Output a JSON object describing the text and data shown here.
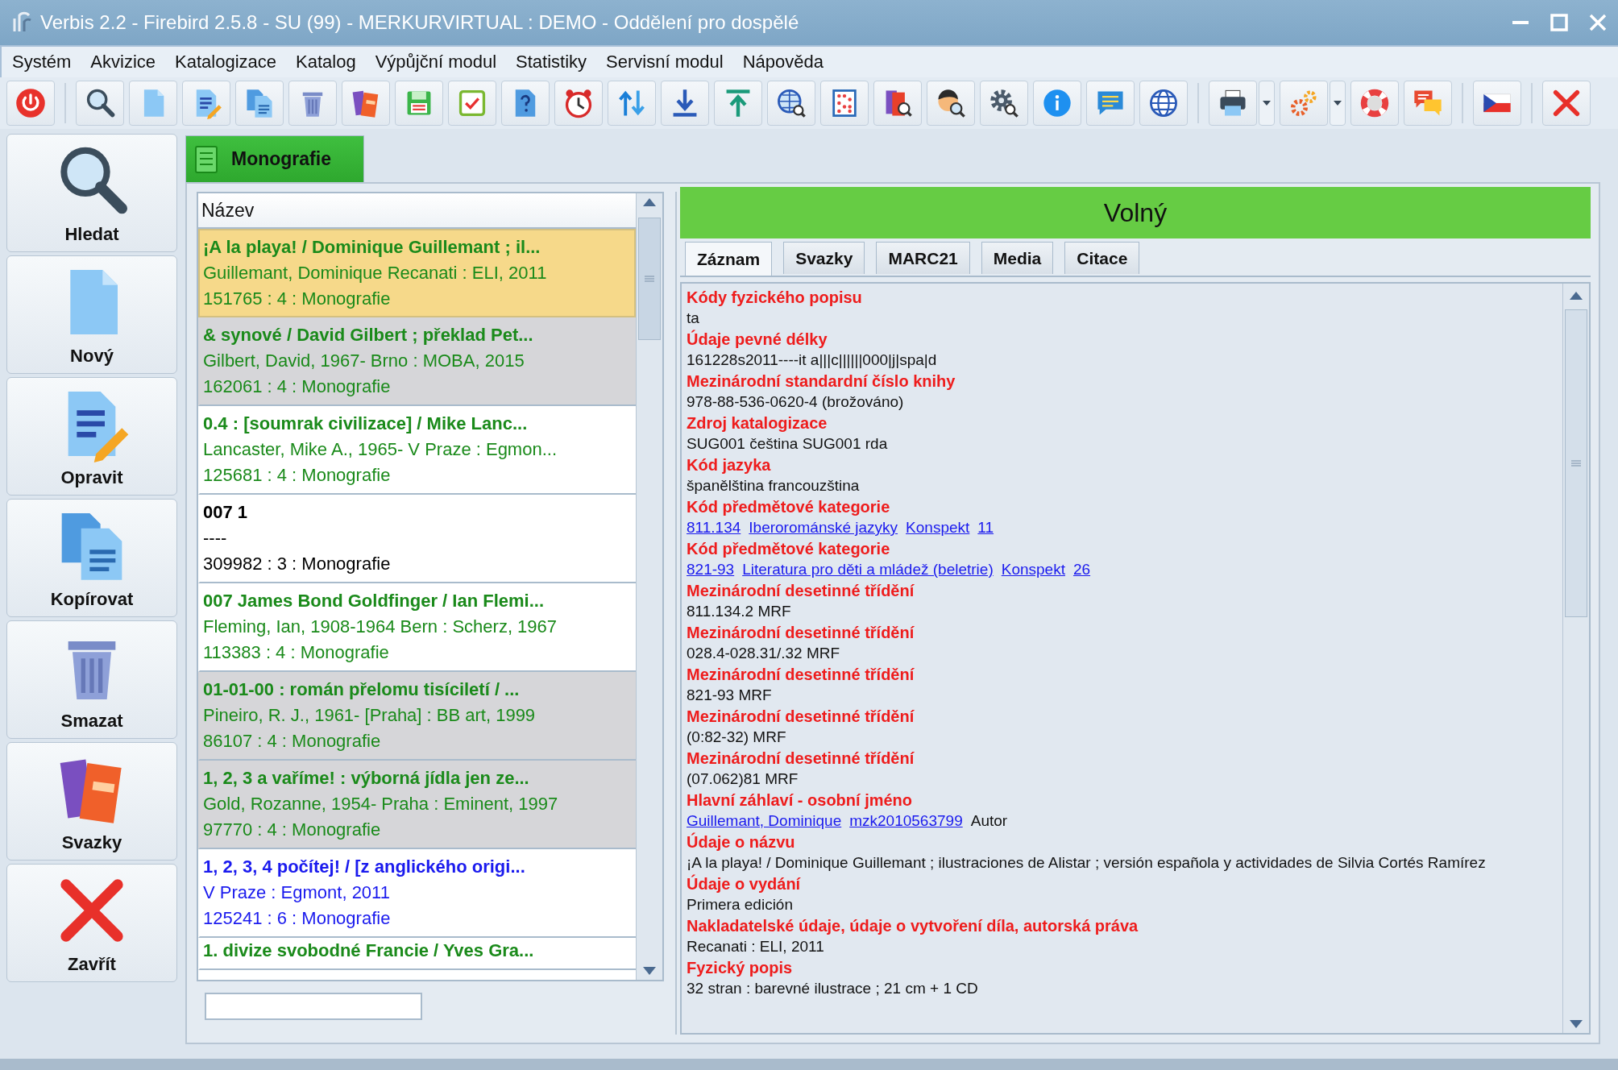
{
  "window": {
    "title": "Verbis 2.2 - Firebird 2.5.8 - SU (99) - MERKURVIRTUAL : DEMO - Oddělení pro dospělé"
  },
  "menu": [
    "Systém",
    "Akvizice",
    "Katalogizace",
    "Katalog",
    "Výpůjční modul",
    "Statistiky",
    "Servisní modul",
    "Nápověda"
  ],
  "sidebar": {
    "items": [
      {
        "label": "Hledat"
      },
      {
        "label": "Nový"
      },
      {
        "label": "Opravit"
      },
      {
        "label": "Kopírovat"
      },
      {
        "label": "Smazat"
      },
      {
        "label": "Svazky"
      },
      {
        "label": "Zavřít"
      }
    ]
  },
  "document_tab": {
    "label": "Monografie",
    "selected": true
  },
  "list": {
    "column": "Název",
    "rows": [
      {
        "title": "¡A la playa! / Dominique Guillemant ; il...",
        "line_2": "Guillemant, Dominique Recanati : ELI, 2011",
        "line_3": "151765 : 4 : Monografie",
        "color": "#1a8a1a",
        "shaded": false,
        "selected": true
      },
      {
        "title": "& synové / David Gilbert ; překlad Pet...",
        "line_2": "Gilbert, David, 1967- Brno : MOBA, 2015",
        "line_3": "162061 : 4 : Monografie",
        "color": "#1a8a1a",
        "shaded": true,
        "selected": false
      },
      {
        "title": "0.4 : [soumrak civilizace] / Mike Lanc...",
        "line_2": "Lancaster, Mike A., 1965- V Praze : Egmon...",
        "line_3": "125681 : 4 : Monografie",
        "color": "#1a8a1a",
        "shaded": false,
        "selected": false
      },
      {
        "title": "007 1",
        "line_2": "----",
        "line_3": "309982 : 3 : Monografie",
        "color": "#000000",
        "shaded": false,
        "selected": false
      },
      {
        "title": "007 James Bond Goldfinger / Ian Flemi...",
        "line_2": "Fleming, Ian, 1908-1964 Bern : Scherz, 1967",
        "line_3": "113383 : 4 : Monografie",
        "color": "#1a8a1a",
        "shaded": false,
        "selected": false
      },
      {
        "title": "01-01-00 : román přelomu tisíciletí / ...",
        "line_2": "Pineiro, R. J., 1961- [Praha] : BB art, 1999",
        "line_3": "86107 : 4 : Monografie",
        "color": "#1a8a1a",
        "shaded": true,
        "selected": false
      },
      {
        "title": "1, 2, 3 a vaříme! : výborná jídla jen ze...",
        "line_2": "Gold, Rozanne, 1954- Praha : Eminent, 1997",
        "line_3": "97770 : 4 : Monografie",
        "color": "#1a8a1a",
        "shaded": true,
        "selected": false
      },
      {
        "title": "1, 2, 3, 4 počítej! / [z anglického origi...",
        "line_2": "V Praze : Egmont, 2011",
        "line_3": "125241 : 6 : Monografie",
        "color": "#1a1aee",
        "shaded": false,
        "selected": false
      },
      {
        "title": "1. divize svobodné Francie / Yves Gra...",
        "color": "#1a8a1a",
        "shaded": false,
        "selected": false
      }
    ]
  },
  "detail": {
    "status": "Volný",
    "tabs": [
      {
        "label": "Záznam",
        "selected": true
      },
      {
        "label": "Svazky",
        "selected": false
      },
      {
        "label": "MARC21",
        "selected": false
      },
      {
        "label": "Media",
        "selected": false
      },
      {
        "label": "Citace",
        "selected": false
      }
    ],
    "fields": [
      {
        "label": "Kódy fyzického popisu",
        "value": [
          {
            "text": "ta",
            "kind": "plain"
          }
        ]
      },
      {
        "label": "Údaje pevné délky",
        "value": [
          {
            "text": "161228s2011----it a|||c||||||000|j|spa|d",
            "kind": "plain"
          }
        ]
      },
      {
        "label": "Mezinárodní standardní číslo knihy",
        "value": [
          {
            "text": "978-88-536-0620-4  (brožováno)",
            "kind": "plain"
          }
        ]
      },
      {
        "label": "Zdroj katalogizace",
        "value": [
          {
            "text": "SUG001  čeština SUG001  rda",
            "kind": "plain"
          }
        ]
      },
      {
        "label": "Kód jazyka",
        "value": [
          {
            "text": "španělština francouzština",
            "kind": "plain"
          }
        ]
      },
      {
        "label": "Kód předmětové kategorie",
        "value": [
          {
            "text": "811.134",
            "kind": "link"
          },
          {
            "text": "Iberorománské jazyky",
            "kind": "link"
          },
          {
            "text": "Konspekt",
            "kind": "link"
          },
          {
            "text": "11",
            "kind": "link"
          }
        ]
      },
      {
        "label": "Kód předmětové kategorie",
        "value": [
          {
            "text": "821-93",
            "kind": "link"
          },
          {
            "text": "Literatura pro děti a mládež (beletrie)",
            "kind": "link"
          },
          {
            "text": "Konspekt",
            "kind": "link"
          },
          {
            "text": "26",
            "kind": "link"
          }
        ]
      },
      {
        "label": "Mezinárodní desetinné třídění",
        "value": [
          {
            "text": "811.134.2  MRF",
            "kind": "plain"
          }
        ]
      },
      {
        "label": "Mezinárodní desetinné třídění",
        "value": [
          {
            "text": "028.4-028.31/.32  MRF",
            "kind": "plain"
          }
        ]
      },
      {
        "label": "Mezinárodní desetinné třídění",
        "value": [
          {
            "text": "821-93  MRF",
            "kind": "plain"
          }
        ]
      },
      {
        "label": "Mezinárodní desetinné třídění",
        "value": [
          {
            "text": "(0:82-32)  MRF",
            "kind": "plain"
          }
        ]
      },
      {
        "label": "Mezinárodní desetinné třídění",
        "value": [
          {
            "text": "(07.062)81  MRF",
            "kind": "plain"
          }
        ]
      },
      {
        "label": "Hlavní záhlaví - osobní jméno",
        "value": [
          {
            "text": "Guillemant, Dominique",
            "kind": "link"
          },
          {
            "text": "mzk2010563799",
            "kind": "link"
          },
          {
            "text": "Autor",
            "kind": "plain"
          }
        ]
      },
      {
        "label": "Údaje o názvu",
        "value": [
          {
            "text": "¡A la playa! /  Dominique Guillemant ; ilustraciones de Alistar ; versión española y actividades de Silvia Cortés Ramírez",
            "kind": "plain"
          }
        ]
      },
      {
        "label": "Údaje o vydání",
        "value": [
          {
            "text": "Primera edición",
            "kind": "plain"
          }
        ]
      },
      {
        "label": "Nakladatelské údaje, údaje o vytvoření díla, autorská práva",
        "value": [
          {
            "text": "Recanati :  ELI,  2011",
            "kind": "plain"
          }
        ]
      },
      {
        "label": "Fyzický popis",
        "value": [
          {
            "text": "32 stran :  barevné ilustrace ;  21 cm +  1 CD",
            "kind": "plain"
          }
        ]
      }
    ]
  }
}
